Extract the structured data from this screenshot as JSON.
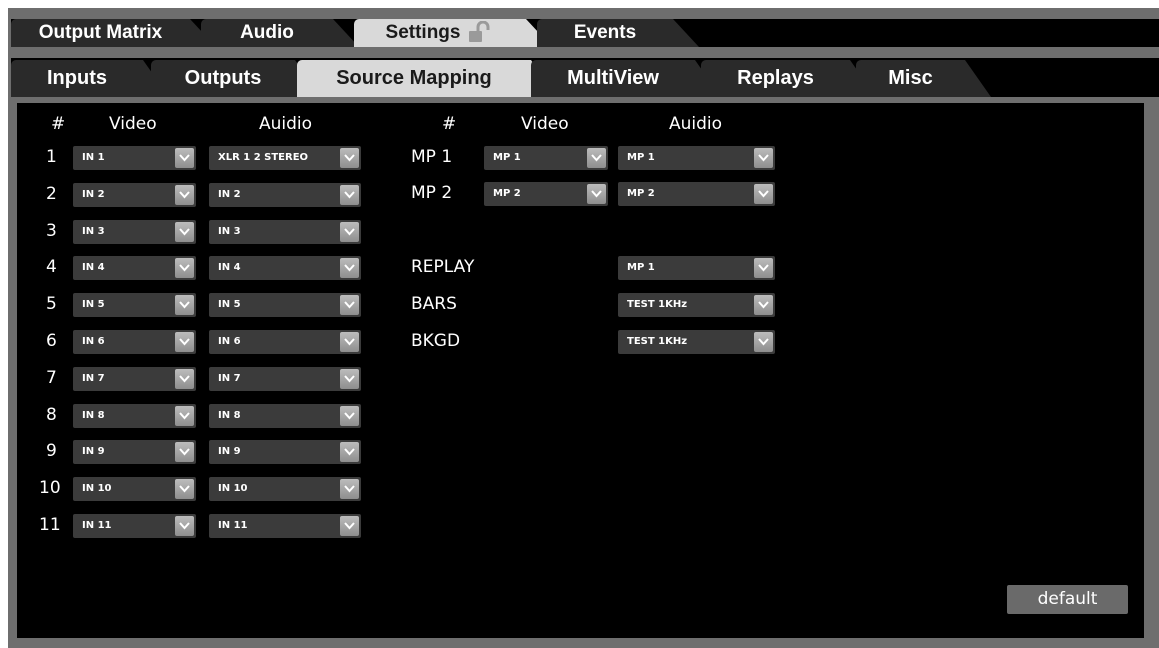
{
  "main_tabs": [
    "Output Matrix",
    "Audio",
    "Settings",
    "Events"
  ],
  "sub_tabs": [
    "Inputs",
    "Outputs",
    "Source Mapping",
    "MultiView",
    "Replays",
    "Misc"
  ],
  "left_table": {
    "headers": {
      "num": "#",
      "video": "Video",
      "audio": "Auidio"
    },
    "rows": [
      {
        "num": "1",
        "video": "IN 1",
        "audio": "XLR 1 2 STEREO"
      },
      {
        "num": "2",
        "video": "IN 2",
        "audio": "IN 2"
      },
      {
        "num": "3",
        "video": "IN 3",
        "audio": "IN 3"
      },
      {
        "num": "4",
        "video": "IN 4",
        "audio": "IN 4"
      },
      {
        "num": "5",
        "video": "IN 5",
        "audio": "IN 5"
      },
      {
        "num": "6",
        "video": "IN 6",
        "audio": "IN 6"
      },
      {
        "num": "7",
        "video": "IN 7",
        "audio": "IN 7"
      },
      {
        "num": "8",
        "video": "IN 8",
        "audio": "IN 8"
      },
      {
        "num": "9",
        "video": "IN 9",
        "audio": "IN 9"
      },
      {
        "num": "10",
        "video": "IN 10",
        "audio": "IN 10"
      },
      {
        "num": "11",
        "video": "IN 11",
        "audio": "IN 11"
      }
    ]
  },
  "right_table": {
    "headers": {
      "num": "#",
      "video": "Video",
      "audio": "Auidio"
    },
    "rows": [
      {
        "label": "MP 1",
        "video": "MP 1",
        "audio": "MP 1"
      },
      {
        "label": "MP 2",
        "video": "MP 2",
        "audio": "MP 2"
      },
      {
        "label": "REPLAY",
        "audio": "MP 1"
      },
      {
        "label": "BARS",
        "audio": "TEST 1KHz"
      },
      {
        "label": "BKGD",
        "audio": "TEST 1KHz"
      }
    ]
  },
  "default_button": "default",
  "colors": {
    "tab_active": "#d9d9d9",
    "tab_inactive": "#2a2a2a",
    "panel": "#000000",
    "frame": "#6e6e6e"
  }
}
